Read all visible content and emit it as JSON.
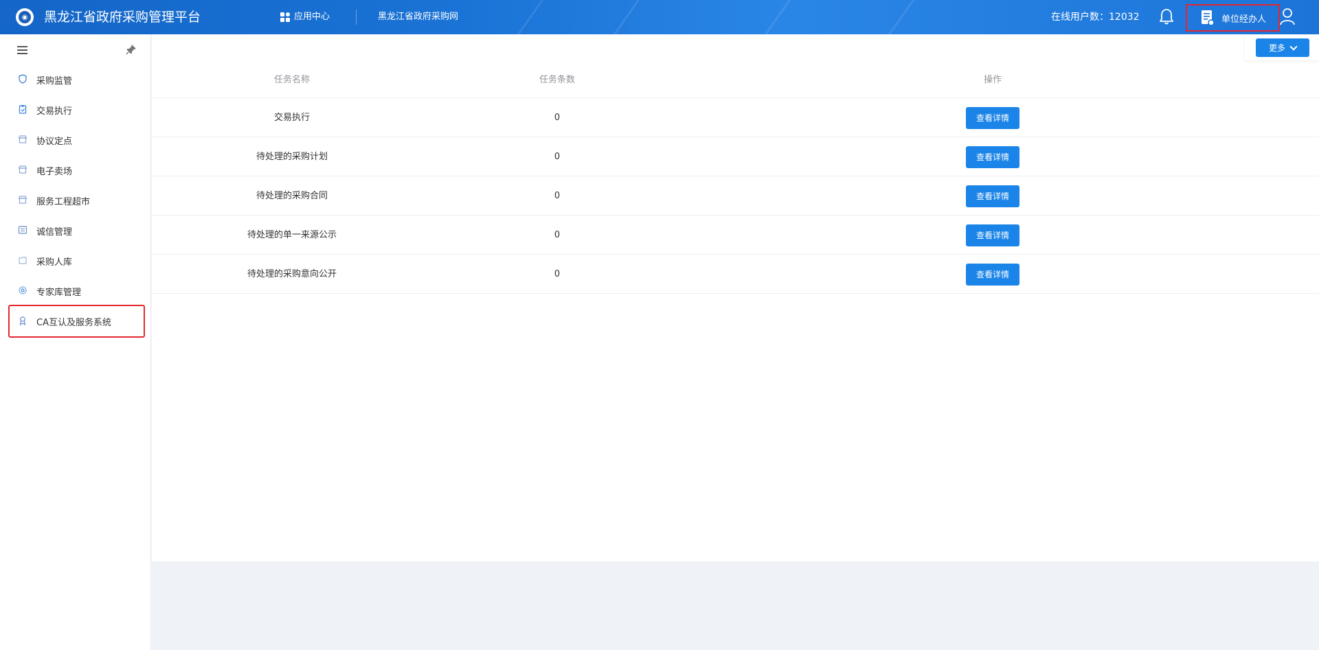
{
  "header": {
    "app_title": "黑龙江省政府采购管理平台",
    "app_center_label": "应用中心",
    "site_link": "黑龙江省政府采购网",
    "online_users": "在线用户数：12032",
    "role_label": "单位经办人",
    "icons": [
      "platform-logo-icon",
      "grid-icon",
      "bell-icon",
      "document-icon",
      "user-icon"
    ]
  },
  "sidebar": {
    "icons": [
      "hamburger-icon",
      "pin-icon"
    ],
    "items": [
      {
        "label": "采购监管",
        "icon": "shield-icon"
      },
      {
        "label": "交易执行",
        "icon": "clipboard-icon"
      },
      {
        "label": "协议定点",
        "icon": "store-icon"
      },
      {
        "label": "电子卖场",
        "icon": "store-icon"
      },
      {
        "label": "服务工程超市",
        "icon": "store-icon"
      },
      {
        "label": "诚信管理",
        "icon": "list-icon"
      },
      {
        "label": "采购人库",
        "icon": "folder-icon"
      },
      {
        "label": "专家库管理",
        "icon": "gear-icon"
      },
      {
        "label": "CA互认及服务系统",
        "icon": "badge-icon"
      }
    ]
  },
  "toolbar": {
    "more_label": "更多"
  },
  "table": {
    "headers": [
      "任务名称",
      "任务条数",
      "操作"
    ],
    "rows": [
      {
        "name": "交易执行",
        "count": "0",
        "action": "查看详情"
      },
      {
        "name": "待处理的采购计划",
        "count": "0",
        "action": "查看详情"
      },
      {
        "name": "待处理的采购合同",
        "count": "0",
        "action": "查看详情"
      },
      {
        "name": "待处理的单一来源公示",
        "count": "0",
        "action": "查看详情"
      },
      {
        "name": "待处理的采购意向公开",
        "count": "0",
        "action": "查看详情"
      }
    ]
  },
  "colors": {
    "primary": "#1a84e8",
    "header_bg": "#1a73d6",
    "highlight_border": "#e3262f",
    "footer_bg": "#eff2f6"
  }
}
